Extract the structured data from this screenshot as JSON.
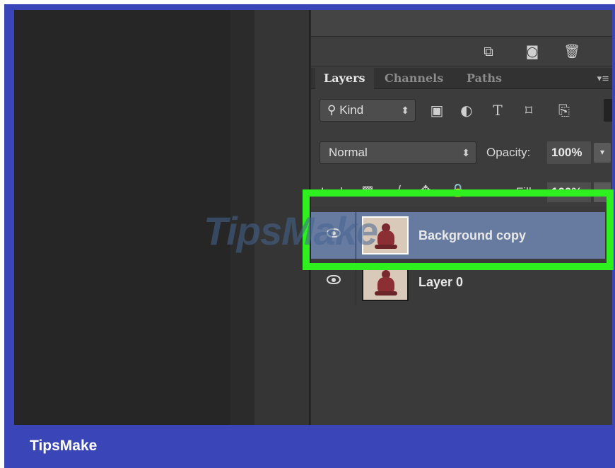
{
  "layers_panel": {
    "tabs": [
      "Layers",
      "Channels",
      "Paths"
    ],
    "active_tab": "Layers",
    "filter": {
      "kind_label": "Kind"
    },
    "blend_mode": "Normal",
    "opacity_label": "Opacity:",
    "opacity_value": "100%",
    "lock_label": "Lock:",
    "fill_label": "Fill:",
    "fill_value": "100%",
    "layers": [
      {
        "name": "Background copy",
        "visible": true,
        "selected": true
      },
      {
        "name": "Layer 0",
        "visible": true,
        "selected": false
      }
    ]
  },
  "watermark": "TipsMake",
  "footer": {
    "brand": "TipsMake"
  },
  "colors": {
    "frame": "#3a46b8",
    "highlight": "#2ef01f",
    "selected_layer": "#677ba0"
  },
  "icons": {
    "top_row": [
      "new-layer-from-comp-icon",
      "camera-icon",
      "trash-icon"
    ],
    "filter_row": [
      "image-filter-icon",
      "adjustment-filter-icon",
      "type-filter-icon",
      "shape-filter-icon",
      "smart-object-filter-icon"
    ],
    "lock_row": [
      "lock-transparent-icon",
      "lock-paint-icon",
      "lock-position-icon",
      "lock-all-icon"
    ]
  }
}
